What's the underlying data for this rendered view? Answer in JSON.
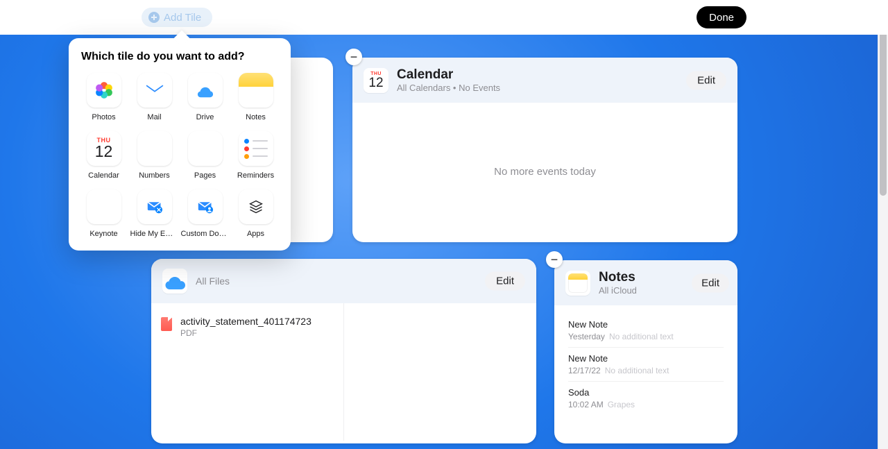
{
  "topbar": {
    "add_tile_label": "Add Tile",
    "done_label": "Done"
  },
  "popover": {
    "title": "Which tile do you want to add?",
    "options": [
      {
        "id": "photos",
        "label": "Photos"
      },
      {
        "id": "mail",
        "label": "Mail"
      },
      {
        "id": "drive",
        "label": "Drive"
      },
      {
        "id": "notes",
        "label": "Notes"
      },
      {
        "id": "calendar",
        "label": "Calendar",
        "day": "THU",
        "num": "12"
      },
      {
        "id": "numbers",
        "label": "Numbers"
      },
      {
        "id": "pages",
        "label": "Pages"
      },
      {
        "id": "reminders",
        "label": "Reminders"
      },
      {
        "id": "keynote",
        "label": "Keynote"
      },
      {
        "id": "hide-my-email",
        "label": "Hide My Email"
      },
      {
        "id": "custom-domain",
        "label": "Custom Dom…"
      },
      {
        "id": "apps",
        "label": "Apps"
      }
    ]
  },
  "calendar_tile": {
    "title": "Calendar",
    "subtitle": "All Calendars • No Events",
    "icon_day": "THU",
    "icon_num": "12",
    "body_text": "No more events today",
    "edit_label": "Edit"
  },
  "drive_tile": {
    "subtitle": "All Files",
    "edit_label": "Edit",
    "files": [
      {
        "name": "activity_statement_401174723",
        "type": "PDF"
      }
    ]
  },
  "notes_tile": {
    "title": "Notes",
    "subtitle": "All iCloud",
    "edit_label": "Edit",
    "notes": [
      {
        "title": "New Note",
        "time": "Yesterday",
        "preview": "No additional text"
      },
      {
        "title": "New Note",
        "time": "12/17/22",
        "preview": "No additional text"
      },
      {
        "title": "Soda",
        "time": "10:02 AM",
        "preview": "Grapes"
      }
    ]
  }
}
